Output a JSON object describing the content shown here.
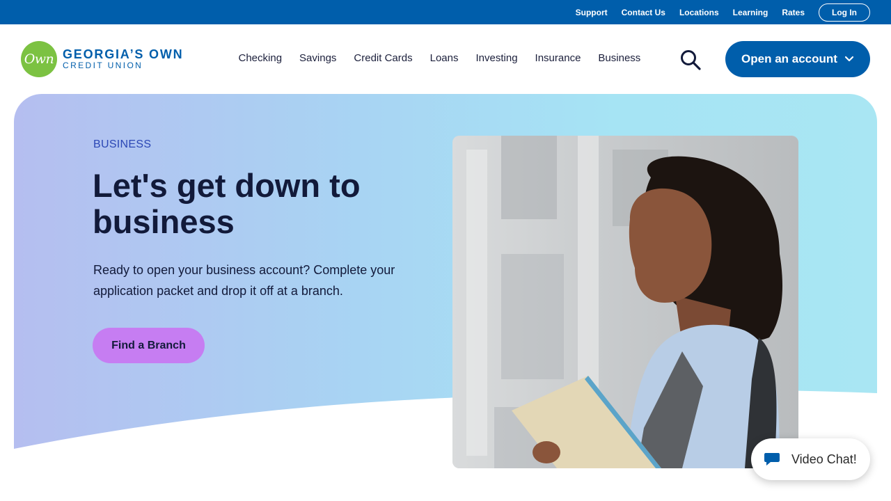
{
  "utility_nav": {
    "links": [
      "Support",
      "Contact Us",
      "Locations",
      "Learning",
      "Rates"
    ],
    "login_label": "Log In"
  },
  "brand": {
    "logo_mark": "Own",
    "name_line1": "GEORGIA’S OWN",
    "name_line2": "CREDIT UNION"
  },
  "main_nav": {
    "links": [
      "Checking",
      "Savings",
      "Credit Cards",
      "Loans",
      "Investing",
      "Insurance",
      "Business"
    ],
    "search_icon": "search-icon",
    "cta_label": "Open an account"
  },
  "hero": {
    "eyebrow": "BUSINESS",
    "headline": "Let's get down to business",
    "subcopy": "Ready to open your business account? Complete your application packet and drop it off at a branch.",
    "button_label": "Find a Branch",
    "image_subject": "woman holding folder outdoors"
  },
  "chat": {
    "label": "Video Chat!",
    "icon": "chat-bubble-icon"
  },
  "colors": {
    "brand_blue": "#005eab",
    "brand_green": "#7cc242",
    "cta_purple": "#c67df2",
    "eyebrow_blue": "#2b47b5",
    "text_dark": "#121a3a"
  }
}
